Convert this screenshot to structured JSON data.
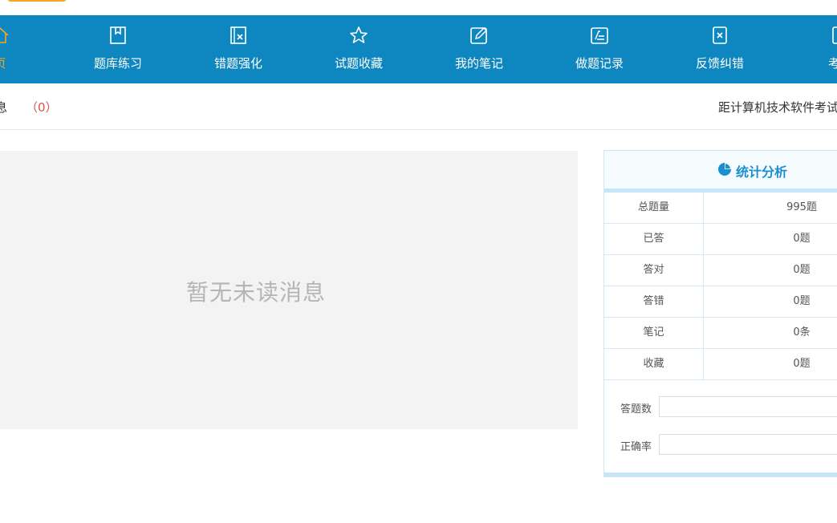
{
  "nav": {
    "items": [
      {
        "label": "页",
        "icon": "home-icon",
        "active": true
      },
      {
        "label": "题库练习",
        "icon": "book-icon",
        "active": false
      },
      {
        "label": "错题强化",
        "icon": "wrong-question-icon",
        "active": false
      },
      {
        "label": "试题收藏",
        "icon": "star-icon",
        "active": false
      },
      {
        "label": "我的笔记",
        "icon": "note-edit-icon",
        "active": false
      },
      {
        "label": "做题记录",
        "icon": "record-icon",
        "active": false
      },
      {
        "label": "反馈纠错",
        "icon": "feedback-icon",
        "active": false
      },
      {
        "label": "考试",
        "icon": "exam-icon",
        "active": false
      }
    ]
  },
  "messages": {
    "label": "息",
    "count": "（0）",
    "empty_text": "暂无未读消息"
  },
  "countdown": {
    "text": "距计算机技术软件考试"
  },
  "stats": {
    "title": "统计分析",
    "rows": [
      {
        "label": "总题量",
        "value": "995题"
      },
      {
        "label": "已答",
        "value": "0题"
      },
      {
        "label": "答对",
        "value": "0题"
      },
      {
        "label": "答错",
        "value": "0题"
      },
      {
        "label": "笔记",
        "value": "0条"
      },
      {
        "label": "收藏",
        "value": "0题"
      }
    ],
    "inputs": [
      {
        "label": "答题数",
        "value": ""
      },
      {
        "label": "正确率",
        "value": ""
      }
    ]
  },
  "colors": {
    "nav_bg": "#0e87c0",
    "active": "#f5a623",
    "accent": "#1a8fcf",
    "count": "#d9534f"
  }
}
